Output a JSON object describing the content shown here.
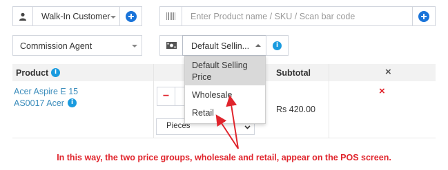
{
  "customer": {
    "selected": "Walk-In Customer",
    "icon": "user-icon",
    "add_icon": "plus-circle-icon"
  },
  "product_search": {
    "placeholder": "Enter Product name / SKU / Scan bar code",
    "icon": "barcode-icon",
    "add_icon": "plus-circle-icon"
  },
  "commission_agent": {
    "selected": "Commission Agent"
  },
  "price_group": {
    "selected": "Default Sellin...",
    "icon": "money-icon",
    "info_icon": "info-icon",
    "options": [
      "Default Selling Price",
      "Wholesale",
      "Retail"
    ],
    "option_lines": [
      [
        "Default Selling",
        "Price"
      ],
      [
        "Wholesale"
      ],
      [
        "Retail"
      ]
    ],
    "active_index": 0
  },
  "table": {
    "headers": {
      "product": "Product",
      "subtotal": "Subtotal",
      "remove": "×"
    },
    "rows": [
      {
        "product_name": "Acer Aspire E 15",
        "product_sku": "AS0017 Acer",
        "quantity_minus": "−",
        "unit": "Pieces",
        "subtotal": "Rs 420.00",
        "remove": "×"
      }
    ]
  },
  "annotation": {
    "text": "In this way, the two price groups, wholesale and retail, appear on the POS screen.",
    "color": "#e0242c"
  },
  "colors": {
    "accent_blue": "#1a74d9",
    "link_blue": "#3c8dbc",
    "danger_red": "#e0242c",
    "border": "#d2d6de"
  }
}
